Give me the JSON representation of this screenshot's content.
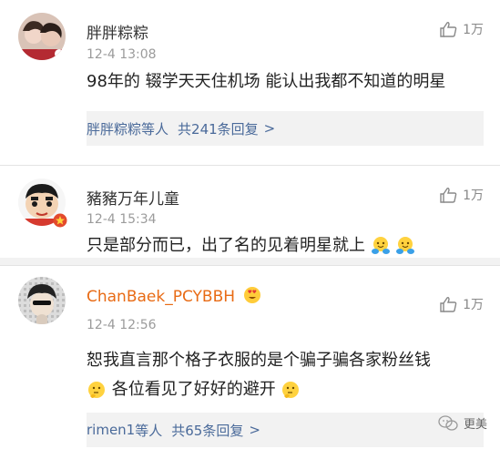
{
  "comments": [
    {
      "username": "胖胖粽粽",
      "time": "12-4 13:08",
      "text": "98年的 辍学天天住机场 能认出我都不知道的明星",
      "likes": "1万",
      "reply_names": "胖胖粽粽",
      "reply_mid": "等人",
      "reply_count": "共241条回复",
      "reply_arrow": ">"
    },
    {
      "username": "豬豬万年儿童",
      "time": "12-4 15:34",
      "text": "只是部分而已，出了名的见着明星就上",
      "likes": "1万"
    },
    {
      "username": "ChanBaek_PCYBBH",
      "time": "12-4 12:56",
      "text_line1": "恕我直言那个格子衣服的是个骗子骗各家粉丝钱",
      "text_line2": "各位看见了好好的避开",
      "likes": "1万",
      "reply_names": "rimen1",
      "reply_mid": "等人",
      "reply_count": "共65条回复",
      "reply_arrow": ">"
    }
  ],
  "watermark": {
    "text": "更美",
    "icon": "wechat-icon"
  },
  "icons": {
    "like": "thumbs-up-icon",
    "emoji_hug": "hug-emoji-icon",
    "emoji_think": "thinking-emoji-icon",
    "badge": "vip-badge-icon",
    "avatar_deco": "heart-eyes-emoji-icon"
  },
  "colors": {
    "link": "#4a6a9a",
    "orange_name": "#e86b15",
    "meta": "#9b9b9b",
    "reply_bg": "#f2f2f2"
  }
}
